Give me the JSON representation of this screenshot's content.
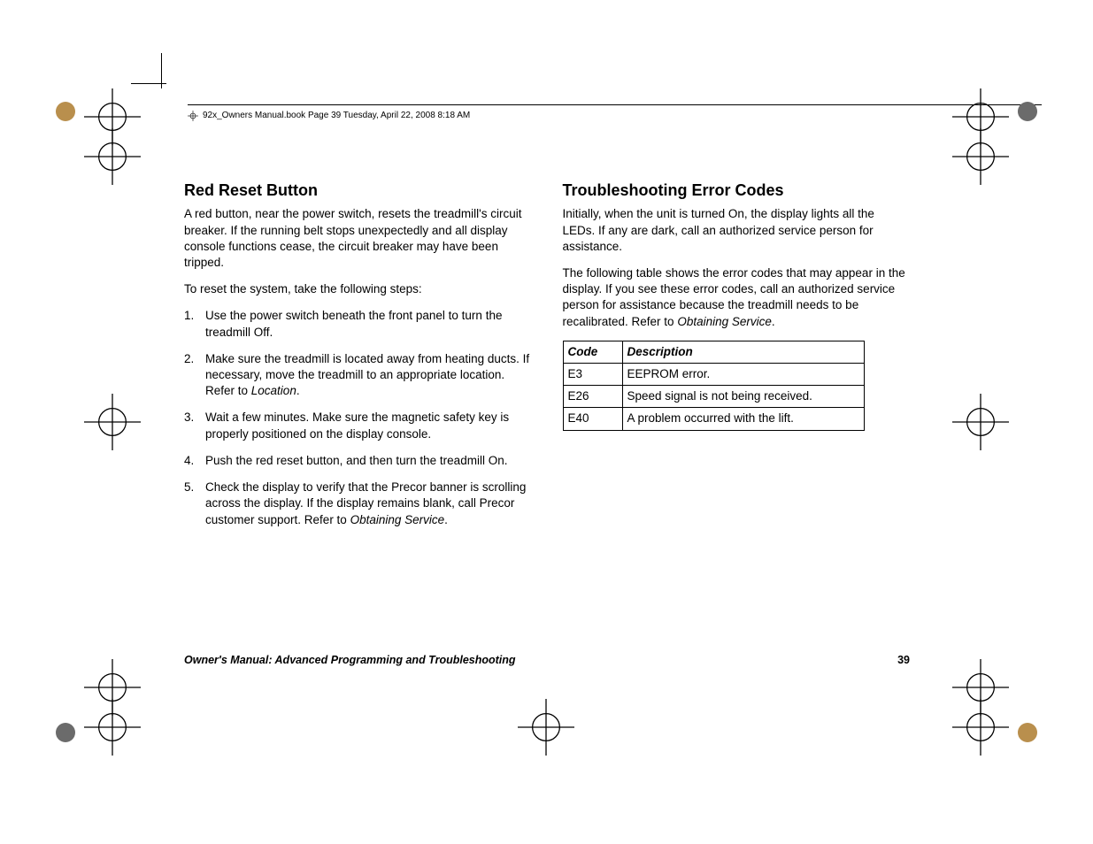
{
  "header": {
    "text": "92x_Owners Manual.book  Page 39  Tuesday, April 22, 2008  8:18 AM"
  },
  "left": {
    "heading": "Red Reset Button",
    "p1": "A red button, near the power switch, resets the treadmill's circuit breaker. If the running belt stops unexpectedly and all display console functions cease, the circuit breaker may have been tripped.",
    "p2": "To reset the system, take the following steps:",
    "steps": {
      "n1": "1.",
      "s1": "Use the power switch beneath the front panel to turn the treadmill Off.",
      "n2": "2.",
      "s2a": "Make sure the treadmill is located away from heating ducts. If necessary, move the treadmill to an appropriate location. Refer to ",
      "s2b": "Location",
      "s2c": ".",
      "n3": "3.",
      "s3": "Wait a few minutes. Make sure the magnetic safety key is properly positioned on the display console.",
      "n4": "4.",
      "s4": "Push the red reset button, and then turn the treadmill On.",
      "n5": "5.",
      "s5a": "Check the display to verify that the Precor banner is scrolling across the display. If the display remains blank, call Precor customer support. Refer to ",
      "s5b": "Obtaining Service",
      "s5c": "."
    }
  },
  "right": {
    "heading": "Troubleshooting Error Codes",
    "p1": "Initially, when the unit is turned On, the display lights all the LEDs. If any are dark, call an authorized service person for assistance.",
    "p2a": "The following table shows the error codes that may appear in the display. If you see these error codes, call an authorized service person for assistance because the treadmill needs to be recalibrated. Refer to ",
    "p2b": "Obtaining Service",
    "p2c": ".",
    "table": {
      "h1": "Code",
      "h2": "Description",
      "r1c1": "E3",
      "r1c2": "EEPROM error.",
      "r2c1": "E26",
      "r2c2": "Speed signal is not being received.",
      "r3c1": "E40",
      "r3c2": "A problem occurred with the lift."
    }
  },
  "footer": {
    "title": "Owner's Manual: Advanced Programming and Troubleshooting",
    "page": "39"
  }
}
